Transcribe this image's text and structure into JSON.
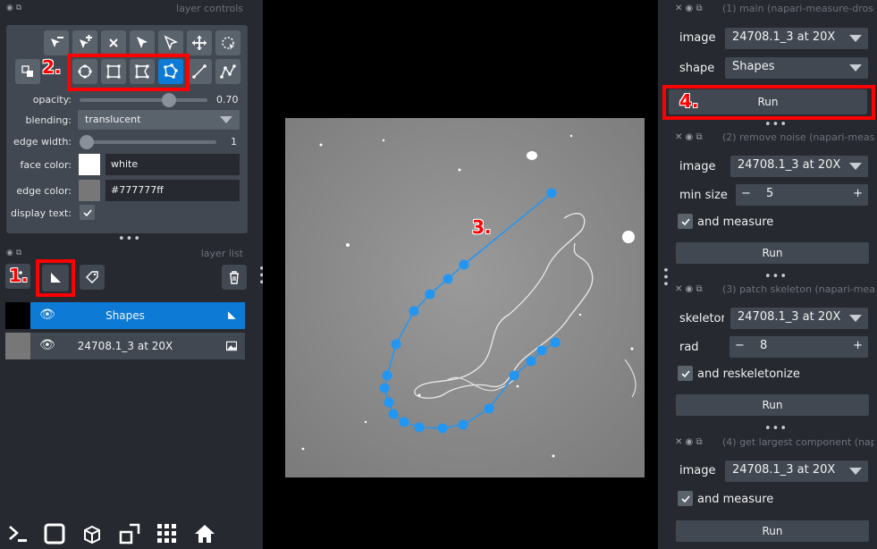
{
  "layer_controls": {
    "header": "layer controls",
    "opacity_label": "opacity:",
    "opacity_value": "0.70",
    "blending_label": "blending:",
    "blending_value": "translucent",
    "edge_width_label": "edge width:",
    "edge_width_value": "1",
    "face_color_label": "face color:",
    "face_color_value": "white",
    "edge_color_label": "edge color:",
    "edge_color_value": "#777777ff",
    "display_text_label": "display text:",
    "opacity_fraction": 0.7,
    "edge_width_fraction": 0.0
  },
  "layer_list": {
    "header": "layer list",
    "layers": [
      {
        "name": "Shapes",
        "selected": true
      },
      {
        "name": "24708.1_3 at 20X",
        "selected": false
      }
    ]
  },
  "annotations": {
    "a1": "1.",
    "a2": "2.",
    "a3": "3.",
    "a4": "4."
  },
  "widgets": {
    "w1": {
      "title": "(1) main (napari-measure-drosc",
      "image_label": "image",
      "image_value": "24708.1_3 at 20X",
      "shape_label": "shape",
      "shape_value": "Shapes",
      "run": "Run"
    },
    "w2": {
      "title": "(2) remove noise (napari-measu",
      "image_label": "image",
      "image_value": "24708.1_3 at 20X",
      "min_size_label": "min size",
      "min_size_value": "5",
      "measure_label": "and measure",
      "run": "Run"
    },
    "w3": {
      "title": "(3) patch skeleton (napari-meas",
      "skeleton_label": "skeletor",
      "skeleton_value": "24708.1_3 at 20X",
      "rad_label": "rad",
      "rad_value": "8",
      "reskel_label": "and reskeletonize",
      "run": "Run"
    },
    "w4": {
      "title": "(4) get largest component (nap",
      "image_label": "image",
      "image_value": "24708.1_3 at 20X",
      "measure_label": "and measure",
      "run": "Run"
    }
  },
  "colors": {
    "accent": "#0d7bd6",
    "annotation_red": "#ff0000",
    "path_blue": "#2196f3"
  }
}
